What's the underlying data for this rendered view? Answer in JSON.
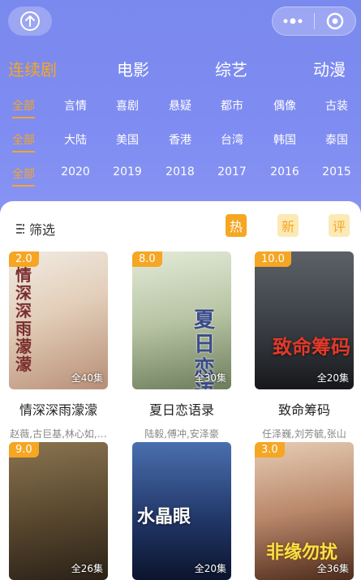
{
  "nav": {
    "home_icon": "home-circle-icon",
    "more_icon": "more-dots-icon",
    "close_icon": "target-icon"
  },
  "categories": [
    {
      "label": "连续剧",
      "active": true
    },
    {
      "label": "电影",
      "active": false
    },
    {
      "label": "综艺",
      "active": false
    },
    {
      "label": "动漫",
      "active": false
    }
  ],
  "filters": {
    "types": [
      "全部",
      "言情",
      "喜剧",
      "悬疑",
      "都市",
      "偶像",
      "古装"
    ],
    "regions": [
      "全部",
      "大陆",
      "美国",
      "香港",
      "台湾",
      "韩国",
      "泰国"
    ],
    "years": [
      "全部",
      "2020",
      "2019",
      "2018",
      "2017",
      "2016",
      "2015"
    ]
  },
  "toolbar": {
    "filter_label": "筛选",
    "filter_icon": "filter-icon",
    "sort_hot": "热",
    "sort_new": "新",
    "sort_rating": "评"
  },
  "shows": [
    {
      "score": "2.0",
      "episodes": "全40集",
      "title": "情深深雨濛濛",
      "actors": "赵薇,古巨基,林心如,…",
      "poster_text": "情深深雨濛濛",
      "colors": [
        "#e9e4dc",
        "#d6c2b0"
      ]
    },
    {
      "score": "8.0",
      "episodes": "全30集",
      "title": "夏日恋语录",
      "actors": "陆毅,傅冲,安泽豪",
      "poster_text": "夏日恋语",
      "colors": [
        "#cfd8c4",
        "#8a9a78"
      ]
    },
    {
      "score": "10.0",
      "episodes": "全20集",
      "title": "致命筹码",
      "actors": "任泽巍,刘芳毓,张山",
      "poster_text": "致命筹码",
      "colors": [
        "#4a5058",
        "#1f2226"
      ]
    },
    {
      "score": "9.0",
      "episodes": "全26集",
      "title": "",
      "actors": "",
      "poster_text": "",
      "colors": [
        "#6b5a3e",
        "#2d2418"
      ]
    },
    {
      "score": "",
      "episodes": "全20集",
      "title": "",
      "actors": "",
      "poster_text": "水晶眼",
      "colors": [
        "#3a5f9a",
        "#0f1d3a"
      ]
    },
    {
      "score": "3.0",
      "episodes": "全36集",
      "title": "",
      "actors": "",
      "poster_text": "非缘勿扰",
      "colors": [
        "#c9a07a",
        "#5a3420"
      ]
    }
  ]
}
